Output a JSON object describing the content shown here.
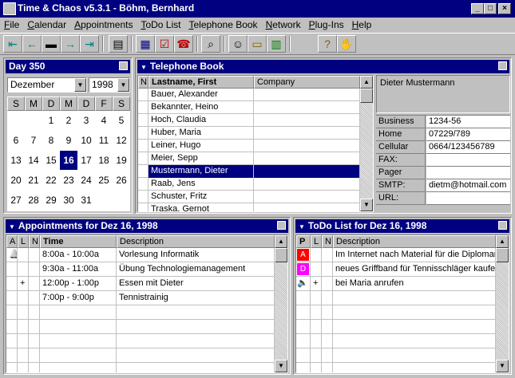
{
  "window": {
    "title": "Time & Chaos v5.3.1 - Böhm, Bernhard"
  },
  "menu": [
    "File",
    "Calendar",
    "Appointments",
    "ToDo List",
    "Telephone Book",
    "Network",
    "Plug-Ins",
    "Help"
  ],
  "calendar": {
    "title": "Day 350",
    "month": "Dezember",
    "year": "1998",
    "weekdays": [
      "S",
      "M",
      "D",
      "M",
      "D",
      "F",
      "S"
    ],
    "weeks": [
      [
        "",
        "",
        "1",
        "2",
        "3",
        "4",
        "5"
      ],
      [
        "6",
        "7",
        "8",
        "9",
        "10",
        "11",
        "12"
      ],
      [
        "13",
        "14",
        "15",
        "16",
        "17",
        "18",
        "19"
      ],
      [
        "20",
        "21",
        "22",
        "23",
        "24",
        "25",
        "26"
      ],
      [
        "27",
        "28",
        "29",
        "30",
        "31",
        "",
        ""
      ]
    ],
    "selected": "16"
  },
  "phonebook": {
    "title": "Telephone Book",
    "col_n": "N",
    "col_name": "Lastname, First",
    "col_company": "Company",
    "entries": [
      "Bauer, Alexander",
      "Bekannter, Heino",
      "Hoch, Claudia",
      "Huber, Maria",
      "Leiner, Hugo",
      "Meier, Sepp",
      "Mustermann, Dieter",
      "Raab, Jens",
      "Schuster, Fritz",
      "Traska, Gernot"
    ],
    "selected": "Mustermann, Dieter"
  },
  "contact": {
    "name": "Dieter Mustermann",
    "fields": [
      {
        "label": "Business",
        "value": "1234-56"
      },
      {
        "label": "Home",
        "value": "07229/789"
      },
      {
        "label": "Cellular",
        "value": "0664/123456789"
      },
      {
        "label": "FAX:",
        "value": ""
      },
      {
        "label": "Pager",
        "value": ""
      },
      {
        "label": "SMTP:",
        "value": "dietm@hotmail.com"
      },
      {
        "label": "URL:",
        "value": ""
      }
    ]
  },
  "appointments": {
    "title": "Appointments for Dez 16, 1998",
    "cols": [
      "A",
      "L",
      "N",
      "Time",
      "Description"
    ],
    "rows": [
      {
        "a": "bell",
        "l": "",
        "time": "8:00a - 10:00a",
        "desc": "Vorlesung Informatik"
      },
      {
        "a": "",
        "l": "",
        "time": "9:30a - 11:00a",
        "desc": "Übung Technologiemanagement"
      },
      {
        "a": "",
        "l": "+",
        "time": "12:00p - 1:00p",
        "desc": "Essen mit Dieter"
      },
      {
        "a": "",
        "l": "",
        "time": "7:00p - 9:00p",
        "desc": "Tennistrainig"
      }
    ]
  },
  "todo": {
    "title": "ToDo List for Dez 16, 1998",
    "cols": [
      "P",
      "L",
      "N",
      "Description"
    ],
    "rows": [
      {
        "p": "A",
        "color": "#ff0000",
        "l": "",
        "desc": "Im Internet nach Material für die Diplomarbeit suchen"
      },
      {
        "p": "D",
        "color": "#ff00ff",
        "l": "",
        "desc": "neues Griffband für Tennisschläger kaufen"
      },
      {
        "p": "speaker",
        "color": "",
        "l": "+",
        "desc": "bei Maria anrufen"
      }
    ]
  },
  "colors": {
    "titlebar": "#000080",
    "selection": "#000080"
  }
}
